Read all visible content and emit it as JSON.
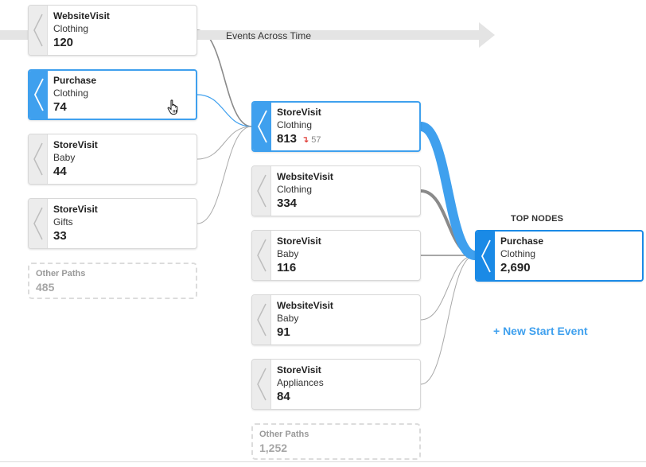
{
  "timeline": {
    "label": "Events Across Time"
  },
  "columns": [
    {
      "nodes": [
        {
          "event": "WebsiteVisit",
          "category": "Clothing",
          "count": "120",
          "state": "normal"
        },
        {
          "event": "Purchase",
          "category": "Clothing",
          "count": "74",
          "state": "active"
        },
        {
          "event": "StoreVisit",
          "category": "Baby",
          "count": "44",
          "state": "normal"
        },
        {
          "event": "StoreVisit",
          "category": "Gifts",
          "count": "33",
          "state": "normal"
        }
      ],
      "other_paths": {
        "label": "Other Paths",
        "count": "485"
      }
    },
    {
      "nodes": [
        {
          "event": "StoreVisit",
          "category": "Clothing",
          "count": "813",
          "drop": "57",
          "state": "active"
        },
        {
          "event": "WebsiteVisit",
          "category": "Clothing",
          "count": "334",
          "state": "normal"
        },
        {
          "event": "StoreVisit",
          "category": "Baby",
          "count": "116",
          "state": "normal"
        },
        {
          "event": "WebsiteVisit",
          "category": "Baby",
          "count": "91",
          "state": "normal"
        },
        {
          "event": "StoreVisit",
          "category": "Appliances",
          "count": "84",
          "state": "normal"
        }
      ],
      "other_paths": {
        "label": "Other Paths",
        "count": "1,252"
      }
    }
  ],
  "top_nodes": {
    "label": "TOP NODES",
    "node": {
      "event": "Purchase",
      "category": "Clothing",
      "count": "2,690",
      "state": "selected"
    }
  },
  "new_start_event": "+ New Start Event",
  "icons": {
    "node_tab": "chevron-left-icon",
    "drop_indicator": "down-arrow-icon",
    "cursor": "hand-pointer-icon"
  },
  "colors": {
    "accent": "#3fa0ee",
    "selected": "#1a8ae6",
    "link": "#a9a9a9",
    "link_strong": "#8a8a8a",
    "drop": "#e0403a",
    "timeline": "#e4e4e4"
  }
}
